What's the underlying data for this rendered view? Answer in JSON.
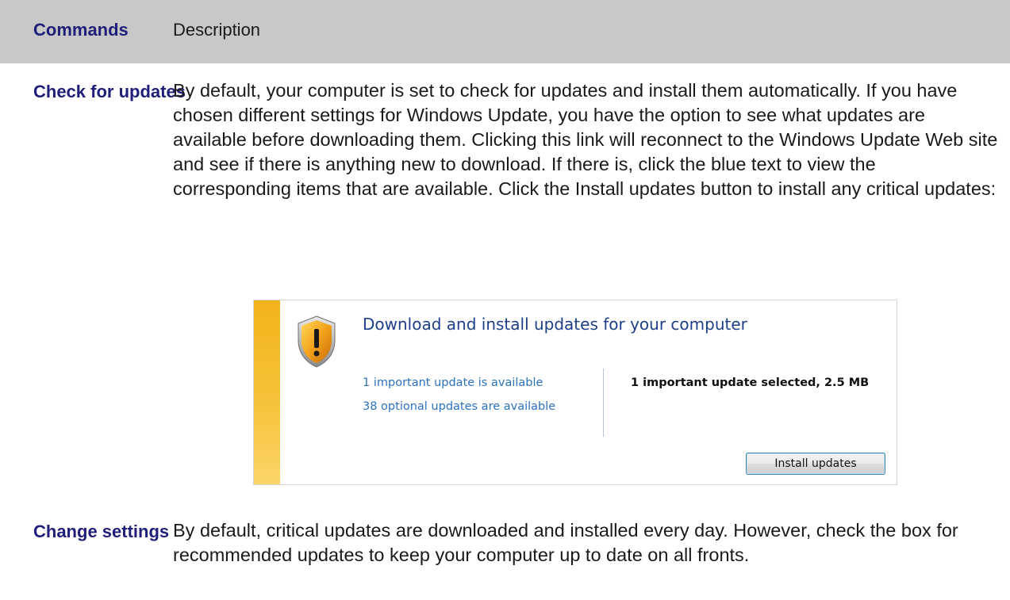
{
  "table_header": {
    "commands": "Commands",
    "description": "Description"
  },
  "rows": [
    {
      "command": "Check for updates",
      "description": "By default, your computer is set to check for updates and install them automatically. If you have chosen different settings for Windows Update, you have the option to see what updates are available before downloading them. Clicking this link will reconnect to the Windows Update Web site and see if there is anything new to download. If there is, click the blue text to view the corresponding items that are available. Click the Install updates button to install any critical updates:"
    },
    {
      "command": "Change settings",
      "description": "By default, critical updates are downloaded and installed every day. However, check the box for recommended updates to keep your computer up to date on all fronts."
    }
  ],
  "windows_update_panel": {
    "title": "Download and install updates for your computer",
    "important_link": "1 important update is available",
    "optional_link": "38 optional updates are available",
    "selected_summary": "1 important update selected, 2.5 MB",
    "install_button": "Install updates",
    "icon": "warning-shield-icon",
    "colors": {
      "title": "#1e3f8a",
      "link": "#2a72c0",
      "stripe": "#f2b21a"
    }
  },
  "colors": {
    "header_background": "#c8c8c8",
    "command_label": "#1f1f7a"
  }
}
